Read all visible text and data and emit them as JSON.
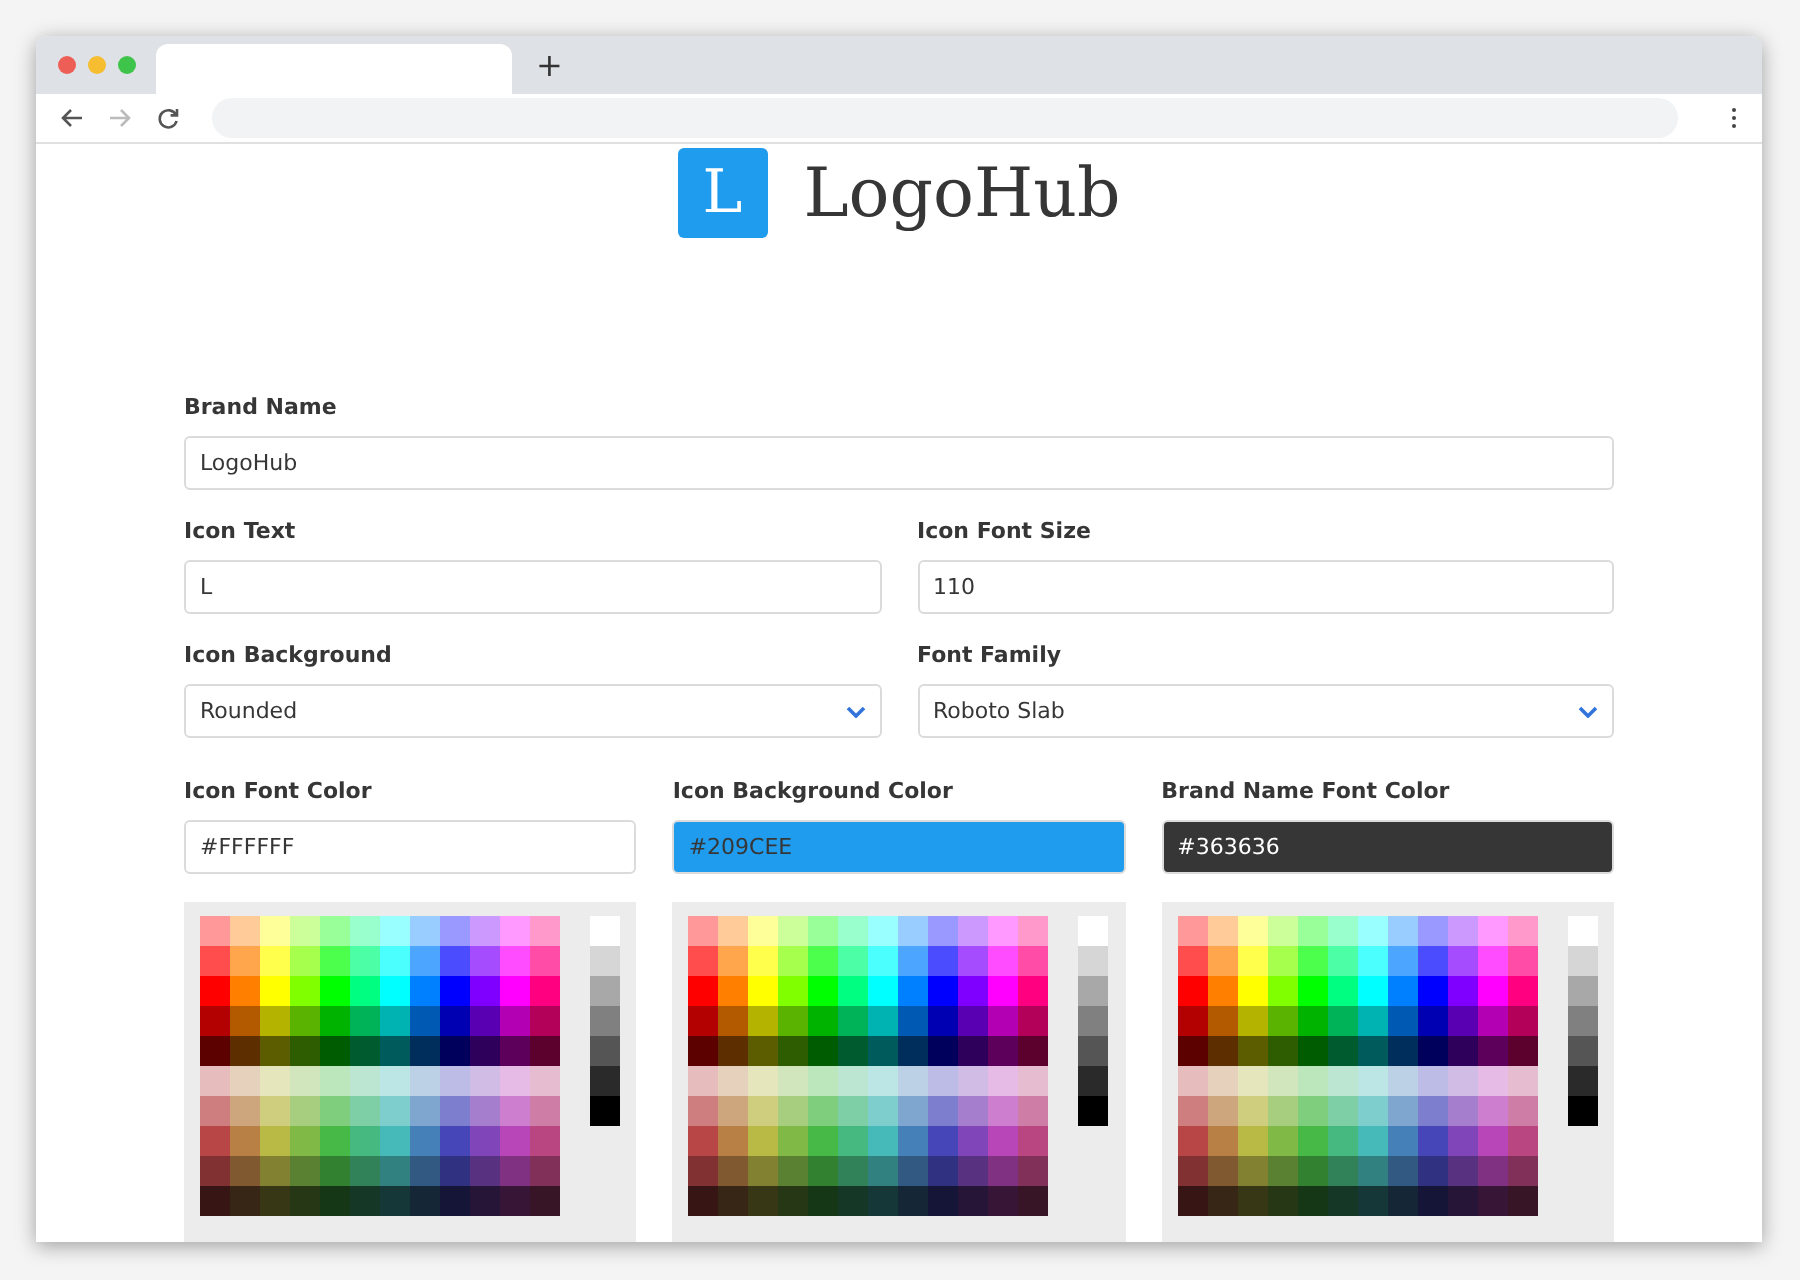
{
  "browser": {
    "new_tab": "+"
  },
  "logo": {
    "icon_text": "L",
    "name": "LogoHub"
  },
  "field_rows": [
    [
      {
        "kind": "text",
        "label": "Brand Name",
        "value": "LogoHub"
      }
    ],
    [
      {
        "kind": "text",
        "label": "Icon Text",
        "value": "L"
      },
      {
        "kind": "text",
        "label": "Icon Font Size",
        "value": "110"
      }
    ],
    [
      {
        "kind": "select",
        "label": "Icon Background",
        "value": "Rounded"
      },
      {
        "kind": "select",
        "label": "Font Family",
        "value": "Roboto Slab"
      }
    ]
  ],
  "color_fields": [
    {
      "label": "Icon Font Color",
      "value": "#FFFFFF",
      "color": "#ffffff"
    },
    {
      "label": "Icon Background Color",
      "value": "#209CEE",
      "color": "#209cee"
    },
    {
      "label": "Brand Name Font Color",
      "value": "#363636",
      "color": "#363636"
    }
  ]
}
